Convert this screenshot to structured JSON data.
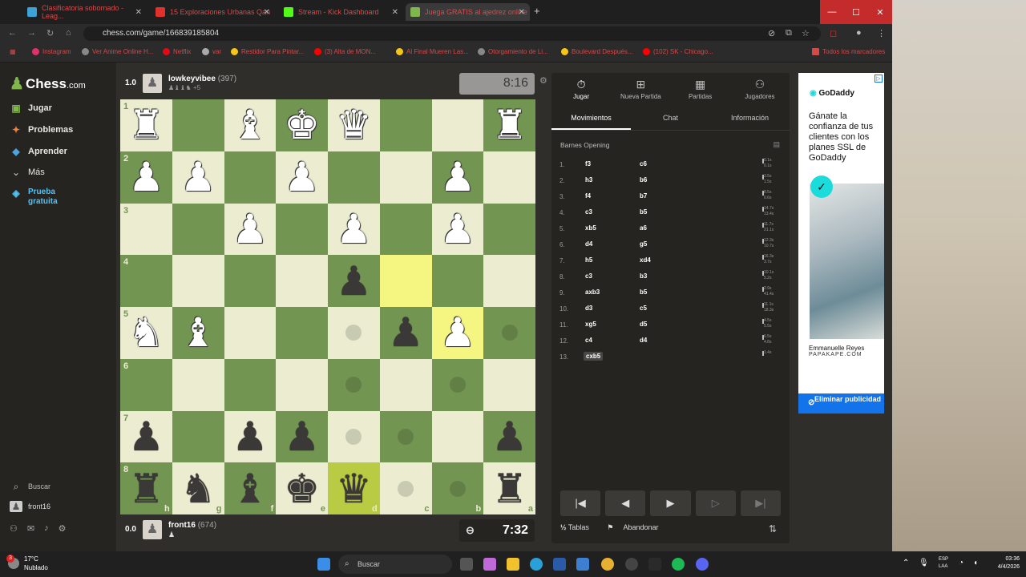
{
  "browser": {
    "tabs": [
      {
        "title": "Clasificatoria sobornado - Leag...",
        "color": "#3ba3d6"
      },
      {
        "title": "15 Exploraciones Urbanas Qan",
        "color": "#e0312d"
      },
      {
        "title": "Stream - Kick Dashboard",
        "color": "#53fc18"
      },
      {
        "title": "Juega GRATIS al ajedrez online",
        "color": "#81b64c"
      }
    ],
    "url": "chess.com/game/166839185804",
    "bookmarks": [
      {
        "label": "Instagram",
        "color": "#e1306c"
      },
      {
        "label": "Ver Anime Online H...",
        "color": "#888888"
      },
      {
        "label": "Netflix",
        "color": "#e50914"
      },
      {
        "label": "var",
        "color": "#aaaaaa"
      },
      {
        "label": "Restidor Para Pintar...",
        "color": "#f5c518"
      },
      {
        "label": "(3) Alta de MON...",
        "color": "#ff0000"
      },
      {
        "label": "Al Final Mueren Las...",
        "color": "#f5c518"
      },
      {
        "label": "Otorgamiento de Li...",
        "color": "#888888"
      },
      {
        "label": "Boulevard Después...",
        "color": "#f5c518"
      },
      {
        "label": "(102) SK - Chicago...",
        "color": "#ff0000"
      }
    ],
    "all_bookmarks": "Todos los marcadores"
  },
  "sidebar": {
    "logo": "Chess",
    "logo_suffix": ".com",
    "items": [
      {
        "label": "Jugar",
        "icon": "play-board-icon"
      },
      {
        "label": "Problemas",
        "icon": "puzzle-icon"
      },
      {
        "label": "Aprender",
        "icon": "learn-icon"
      },
      {
        "label": "Más",
        "icon": "chevron-down-icon"
      },
      {
        "label": "Prueba gratuita",
        "icon": "diamond-icon"
      }
    ],
    "search": "Buscar",
    "user": "front16"
  },
  "top_player": {
    "score": "1.0",
    "name": "lowkeyvibee",
    "rating": "(397)",
    "captured_extra": "+5",
    "clock": "8:16"
  },
  "bottom_player": {
    "score": "0.0",
    "name": "front16",
    "rating": "(674)",
    "clock": "7:32"
  },
  "board": {
    "ranks": [
      "1",
      "2",
      "3",
      "4",
      "5",
      "6",
      "7",
      "8"
    ],
    "files": [
      "h",
      "g",
      "f",
      "e",
      "d",
      "c",
      "b",
      "a"
    ],
    "rows": [
      [
        "wR",
        "",
        "wB",
        "wK",
        "wQ",
        "",
        "",
        "wR"
      ],
      [
        "wP",
        "wP",
        "",
        "wP",
        "",
        "",
        "wP",
        ""
      ],
      [
        "",
        "",
        "wP",
        "",
        "wP",
        "",
        "wP",
        ""
      ],
      [
        "",
        "",
        "",
        "",
        "bP",
        "",
        "",
        ""
      ],
      [
        "wN",
        "wB",
        "",
        "",
        "",
        "bP",
        "wP",
        ""
      ],
      [
        "",
        "",
        "",
        "",
        "",
        "",
        "",
        ""
      ],
      [
        "bP",
        "",
        "bP",
        "bP",
        "",
        "",
        "",
        "bP"
      ],
      [
        "bR",
        "bN",
        "bB",
        "bK",
        "bQ",
        "",
        "",
        "bR"
      ]
    ],
    "highlights": [
      [
        3,
        5
      ],
      [
        4,
        6
      ],
      [
        7,
        4
      ]
    ],
    "dots": [
      [
        4,
        4
      ],
      [
        4,
        7
      ],
      [
        5,
        4
      ],
      [
        5,
        6
      ],
      [
        6,
        4
      ],
      [
        6,
        5
      ],
      [
        7,
        5
      ],
      [
        7,
        6
      ]
    ]
  },
  "panel": {
    "tabs": [
      {
        "label": "Jugar",
        "icon": "stopwatch-icon"
      },
      {
        "label": "Nueva Partida",
        "icon": "plus-square-icon"
      },
      {
        "label": "Partidas",
        "icon": "board-icon"
      },
      {
        "label": "Jugadores",
        "icon": "players-icon"
      }
    ],
    "subtabs": [
      "Movimientos",
      "Chat",
      "Información"
    ],
    "opening": "Barnes Opening",
    "moves": [
      {
        "n": "1.",
        "w": "f3",
        "b": "c6",
        "wt": "0.1s",
        "bt": "0.1s"
      },
      {
        "n": "2.",
        "w": "h3",
        "b": "b6",
        "wt": "3.5s",
        "bt": "1.5s"
      },
      {
        "n": "3.",
        "w": "f4",
        "b": "b7",
        "wt": "8.5s",
        "bt": "0.6s"
      },
      {
        "n": "4.",
        "w": "c3",
        "b": "b5",
        "wt": "14.7s",
        "bt": "13.4s"
      },
      {
        "n": "5.",
        "w": "xb5",
        "b": "a6",
        "wt": "11.7s",
        "bt": "21.1s"
      },
      {
        "n": "6.",
        "w": "d4",
        "b": "g5",
        "wt": "12.3s",
        "bt": "10.7s"
      },
      {
        "n": "7.",
        "w": "h5",
        "b": "xd4",
        "wt": "16.3s",
        "bt": "3.7s"
      },
      {
        "n": "8.",
        "w": "c3",
        "b": "b3",
        "wt": "10.1s",
        "bt": "5.2s"
      },
      {
        "n": "9.",
        "w": "axb3",
        "b": "b5",
        "wt": "2.9s",
        "bt": "41.4s"
      },
      {
        "n": "10.",
        "w": "d3",
        "b": "c5",
        "wt": "11.1s",
        "bt": "18.3s"
      },
      {
        "n": "11.",
        "w": "xg5",
        "b": "d5",
        "wt": "4.5s",
        "bt": "5.5s"
      },
      {
        "n": "12.",
        "w": "c4",
        "b": "d4",
        "wt": "6.5s",
        "bt": "4.8s"
      },
      {
        "n": "13.",
        "w": "cxb5",
        "b": "",
        "wt": "1.4s",
        "bt": ""
      }
    ],
    "tables": "Tablas",
    "resign": "Abandonar"
  },
  "ad": {
    "brand": "GoDaddy",
    "text": "Gánate la confianza de tus clientes con los planes SSL de GoDaddy",
    "person": "Emmanuelle Reyes",
    "company": "PAPAKAPE.COM",
    "cta": "Eliminar publicidad"
  },
  "taskbar": {
    "temp": "17°C",
    "weather": "Nublado",
    "badge": "3",
    "search": "Buscar",
    "lang1": "ESP",
    "lang2": "LAA",
    "time": "03:36",
    "date": "4/4/2026"
  }
}
